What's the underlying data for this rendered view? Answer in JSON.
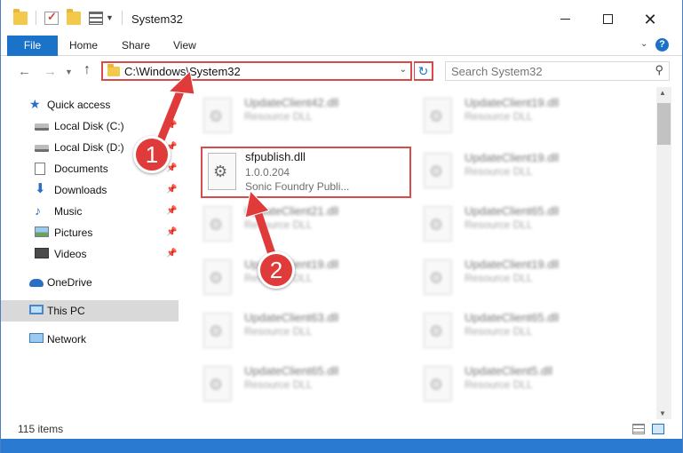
{
  "window": {
    "title": "System32",
    "controls": {
      "minimize": "",
      "maximize": "",
      "close": "✕"
    }
  },
  "ribbon": {
    "tabs": [
      "File",
      "Home",
      "Share",
      "View"
    ],
    "help": "?"
  },
  "address": {
    "path": "C:\\Windows\\System32",
    "refresh": "↻"
  },
  "search": {
    "placeholder": "Search System32"
  },
  "sidebar": {
    "items": [
      {
        "label": "Quick access",
        "icon": "star-icon"
      },
      {
        "label": "Local Disk (C:)",
        "icon": "disk-icon",
        "pinned": true
      },
      {
        "label": "Local Disk (D:)",
        "icon": "disk-icon",
        "pinned": true
      },
      {
        "label": "Documents",
        "icon": "documents-icon",
        "pinned": true
      },
      {
        "label": "Downloads",
        "icon": "downloads-icon",
        "pinned": true
      },
      {
        "label": "Music",
        "icon": "music-icon",
        "pinned": true
      },
      {
        "label": "Pictures",
        "icon": "pictures-icon",
        "pinned": true
      },
      {
        "label": "Videos",
        "icon": "videos-icon",
        "pinned": true
      },
      {
        "label": "OneDrive",
        "icon": "onedrive-icon"
      },
      {
        "label": "This PC",
        "icon": "this-pc-icon",
        "selected": true
      },
      {
        "label": "Network",
        "icon": "network-icon"
      }
    ]
  },
  "files": {
    "left": [
      {
        "name": "UpdateClient42.dll",
        "type": "Resource DLL"
      },
      {
        "name": "UpdateClient21.dll",
        "type": "Resource DLL"
      },
      {
        "name": "UpdateClient19.dll",
        "type": "Resource DLL"
      },
      {
        "name": "UpdateClient63.dll",
        "type": "Resource DLL"
      },
      {
        "name": "UpdateClient65.dll",
        "type": "Resource DLL"
      }
    ],
    "right": [
      {
        "name": "UpdateClient19.dll",
        "type": "Resource DLL"
      },
      {
        "name": "UpdateClient19.dll",
        "type": "Resource DLL"
      },
      {
        "name": "UpdateClient65.dll",
        "type": "Resource DLL"
      },
      {
        "name": "UpdateClient19.dll",
        "type": "Resource DLL"
      },
      {
        "name": "UpdateClient65.dll",
        "type": "Resource DLL"
      },
      {
        "name": "UpdateClient5.dll",
        "type": "Resource DLL"
      }
    ],
    "highlighted": {
      "name": "sfpublish.dll",
      "version": "1.0.0.204",
      "company": "Sonic Foundry Publi..."
    }
  },
  "status": {
    "count": "115 items"
  },
  "annotations": {
    "step1": "1",
    "step2": "2",
    "color": "#e03b3b"
  }
}
